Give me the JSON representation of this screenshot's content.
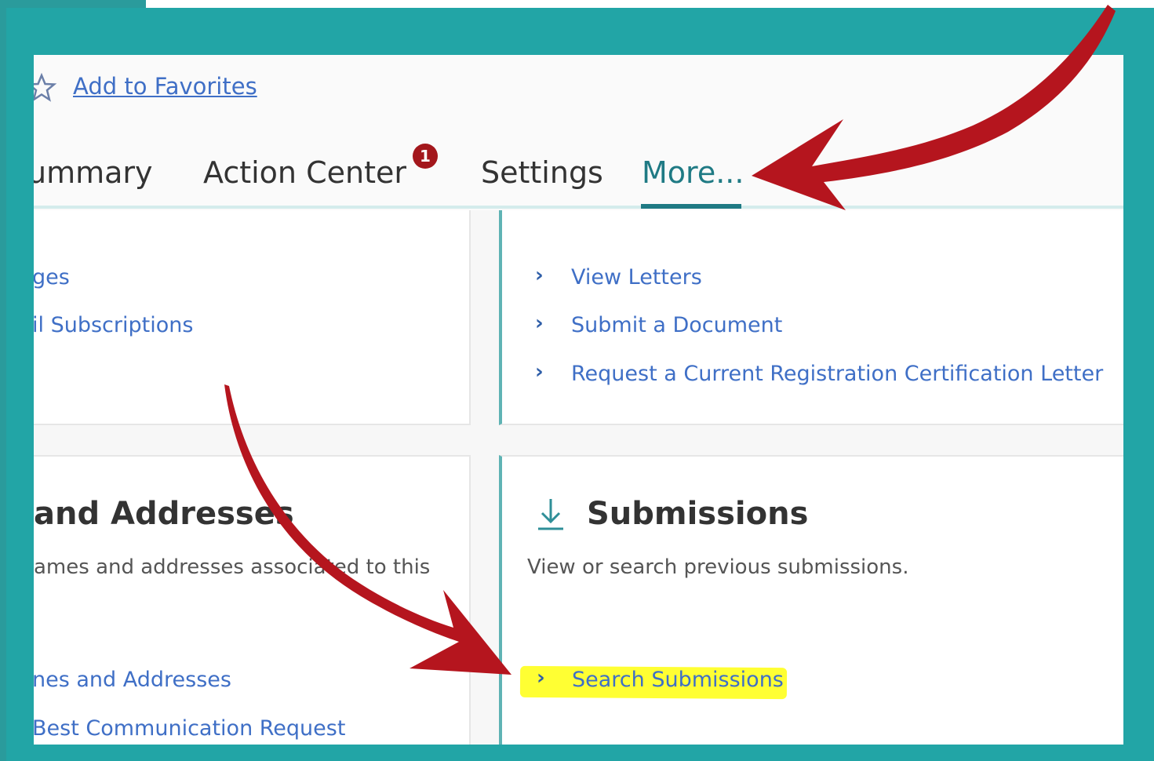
{
  "favorites": {
    "label": "Add to Favorites"
  },
  "tabs": [
    {
      "label": "Summary",
      "display": "ummary"
    },
    {
      "label": "Action Center",
      "badge": "1"
    },
    {
      "label": "Settings"
    },
    {
      "label": "More..."
    }
  ],
  "left_top_links": [
    "ges",
    "il Subscriptions"
  ],
  "right_top_links": [
    "View Letters",
    "Submit a Document",
    "Request a Current Registration Certification Letter"
  ],
  "left_bottom": {
    "heading": "and Addresses",
    "description": "ames and addresses associated to this",
    "links": [
      "nes and Addresses",
      "Best Communication Request"
    ]
  },
  "submissions": {
    "heading": "Submissions",
    "description": "View or search previous submissions.",
    "link": "Search Submissions"
  },
  "colors": {
    "frame": "#22a5a6",
    "accent": "#1f7a84",
    "link": "#3f6fc6",
    "badge": "#a3171c",
    "arrow": "#b5151e",
    "highlight": "#ffff33"
  }
}
